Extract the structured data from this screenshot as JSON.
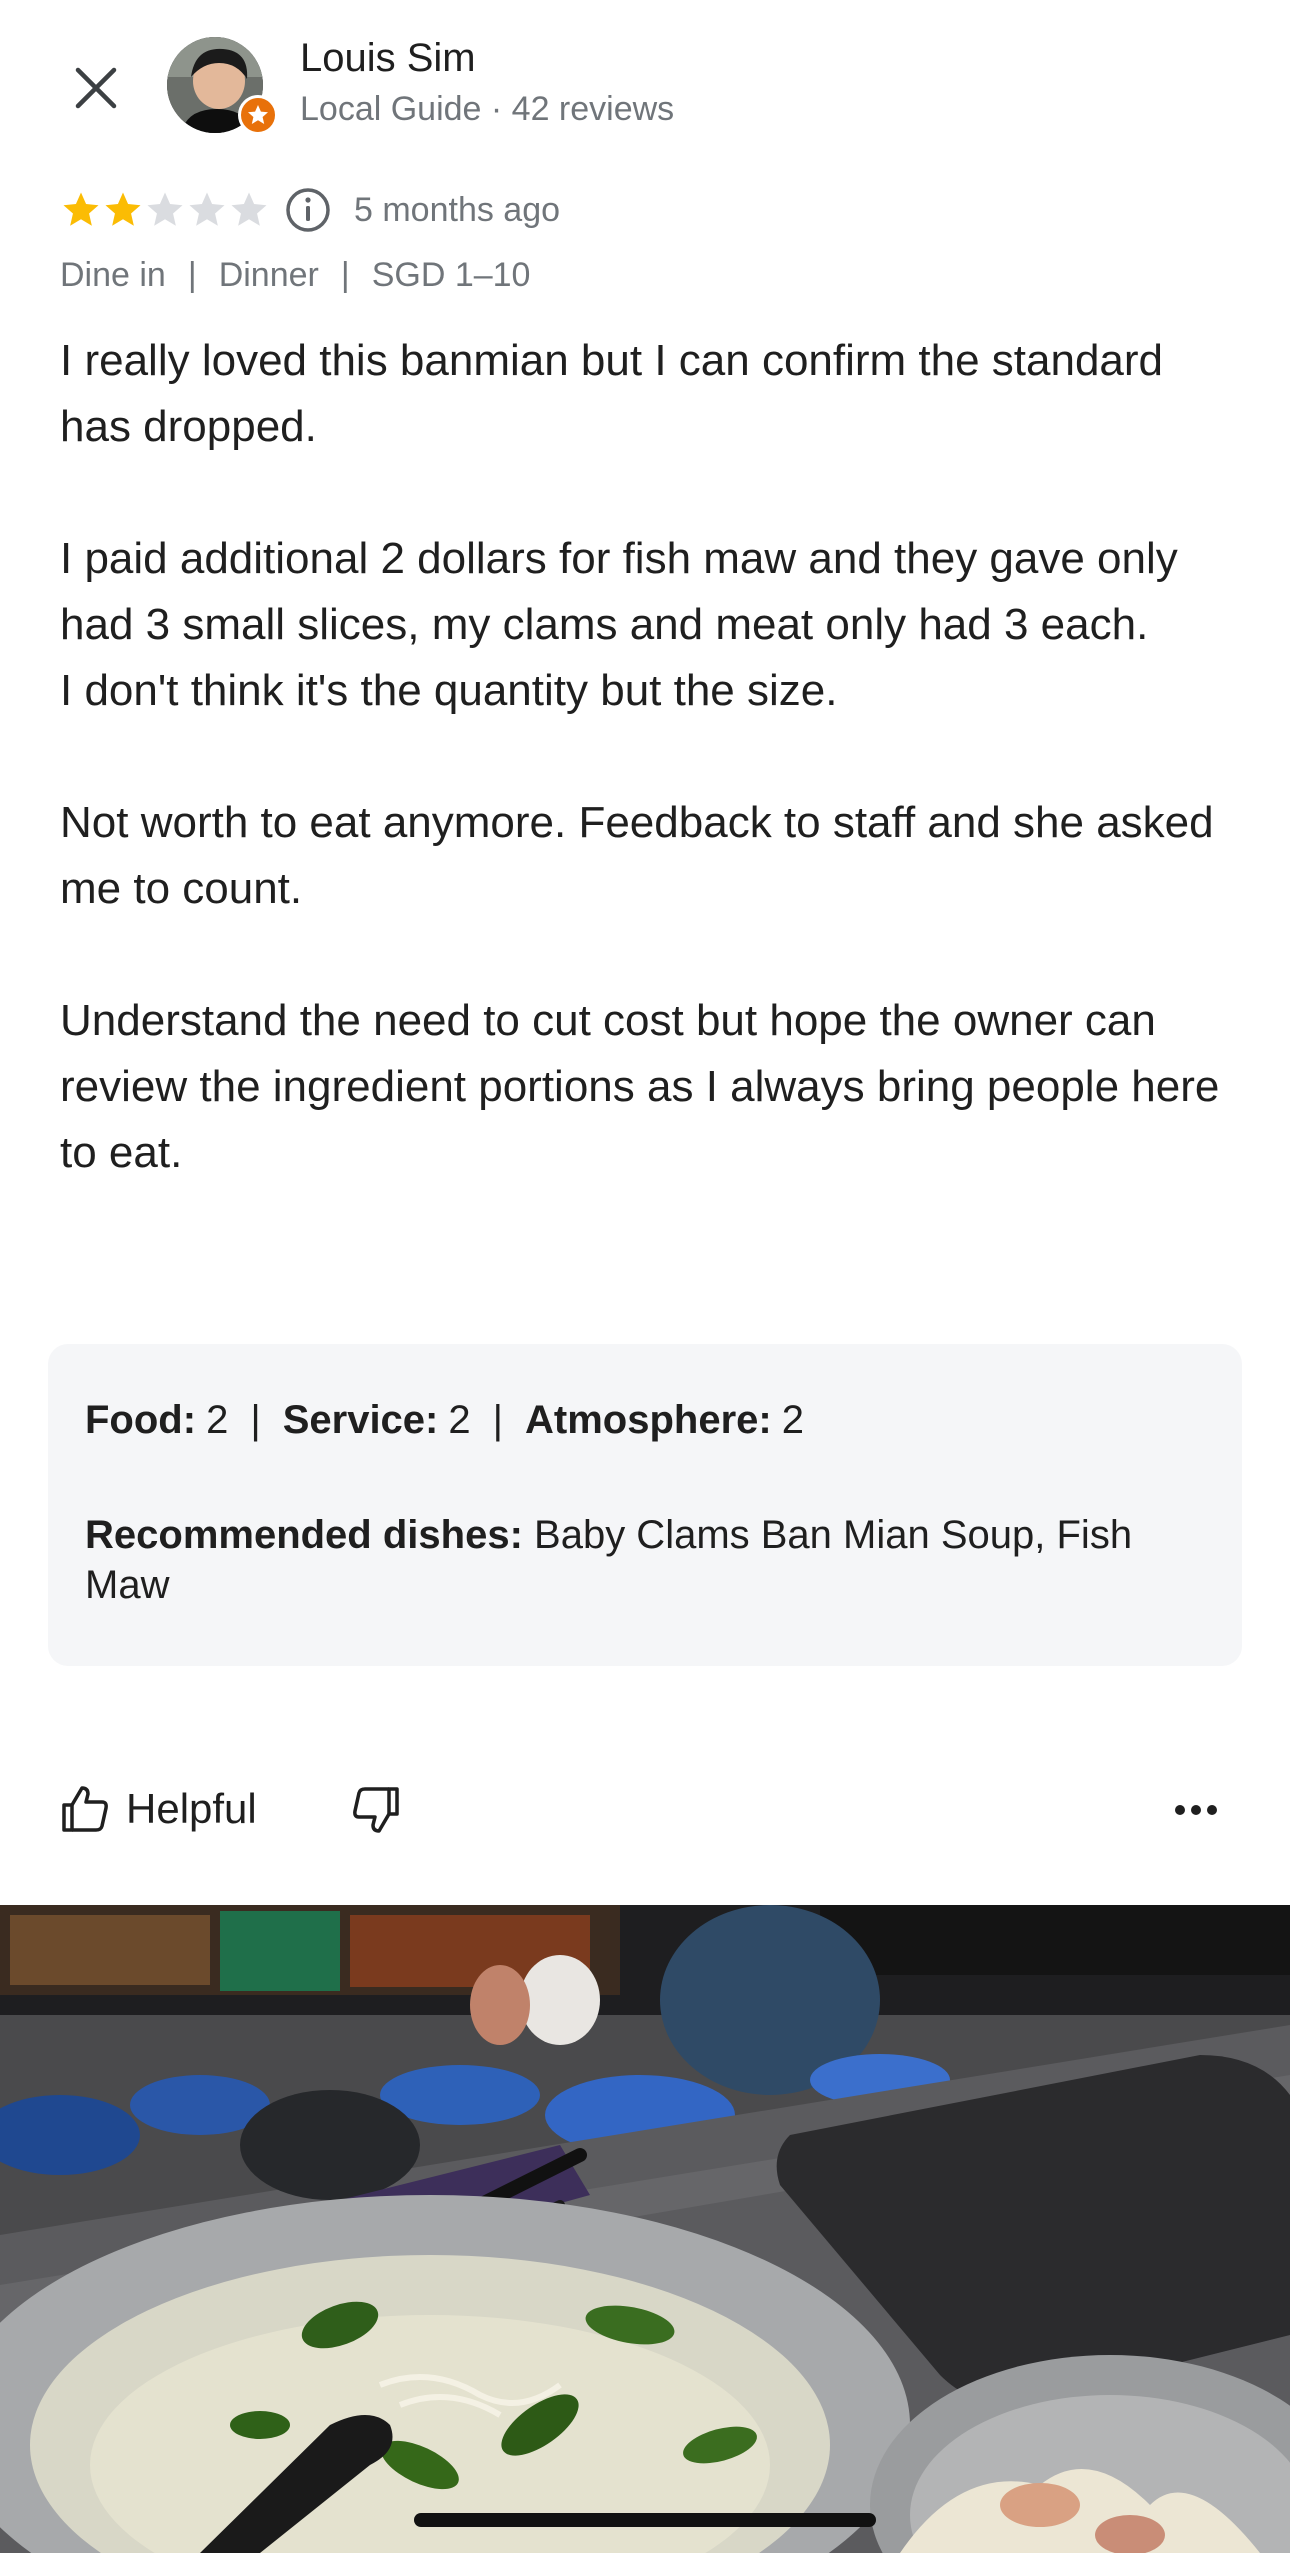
{
  "review": {
    "author": {
      "name": "Louis Sim",
      "meta": "Local Guide · 42 reviews"
    },
    "rating": 2,
    "rating_max": 5,
    "time": "5 months ago",
    "tags": [
      "Dine in",
      "Dinner",
      "SGD 1–10"
    ],
    "paragraphs": [
      [
        "I really loved this banmian but I can confirm the standard has dropped."
      ],
      [
        "I paid additional 2 dollars for fish maw and they gave only had 3 small slices, my clams and meat only had 3 each.",
        "I don't think it's the quantity but the size."
      ],
      [
        "Not worth to eat anymore. Feedback to staff and she asked me to count."
      ],
      [
        "Understand the need to cut cost but hope the owner can review the ingredient portions as I always bring people here to eat."
      ]
    ],
    "sub_ratings": [
      {
        "label": "Food:",
        "value": "2"
      },
      {
        "label": "Service:",
        "value": "2"
      },
      {
        "label": "Atmosphere:",
        "value": "2"
      }
    ],
    "recommended": {
      "label": "Recommended dishes:",
      "value": "Baby Clams Ban Mian Soup, Fish Maw"
    }
  },
  "actions": {
    "helpful_label": "Helpful"
  },
  "icons": {
    "close": "close-icon",
    "info": "info-icon",
    "thumbs_up": "thumbs-up-icon",
    "thumbs_down": "thumbs-down-icon",
    "more": "more-horizontal-icon",
    "guide_badge": "star-badge-icon"
  },
  "colors": {
    "star_filled": "#fbbc04",
    "star_empty": "#dadce0",
    "guide_badge": "#e8710a",
    "secondary_text": "#70757a",
    "card_bg": "#f5f6f8"
  }
}
